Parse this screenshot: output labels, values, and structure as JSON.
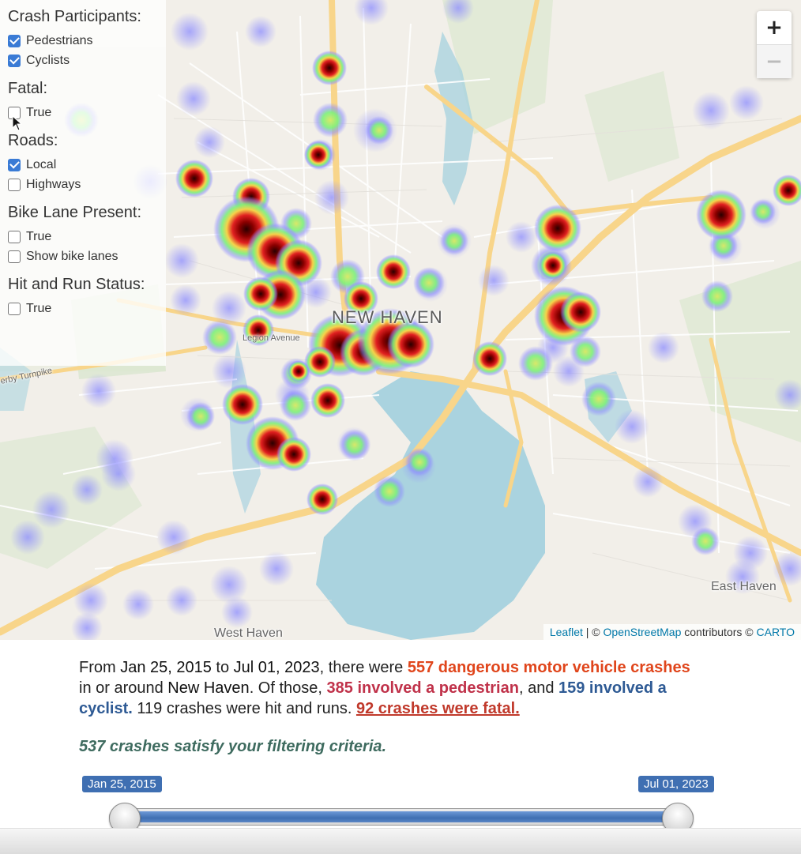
{
  "filters": {
    "groups": [
      {
        "heading": "Crash Participants:",
        "options": [
          {
            "label": "Pedestrians",
            "checked": true
          },
          {
            "label": "Cyclists",
            "checked": true
          }
        ]
      },
      {
        "heading": "Fatal:",
        "options": [
          {
            "label": "True",
            "checked": false
          }
        ]
      },
      {
        "heading": "Roads:",
        "options": [
          {
            "label": "Local",
            "checked": true
          },
          {
            "label": "Highways",
            "checked": false
          }
        ]
      },
      {
        "heading": "Bike Lane Present:",
        "options": [
          {
            "label": "True",
            "checked": false
          },
          {
            "label": "Show bike lanes",
            "checked": false
          }
        ]
      },
      {
        "heading": "Hit and Run Status:",
        "options": [
          {
            "label": "True",
            "checked": false
          }
        ]
      }
    ]
  },
  "map": {
    "labels": {
      "city": "NEW HAVEN",
      "east_haven": "East Haven",
      "west_haven": "West Haven",
      "legion_avenue": "Legion Avenue",
      "turnpike": "erby Turnpike"
    },
    "zoom": {
      "in": "+",
      "out": "−"
    },
    "attribution": {
      "leaflet": "Leaflet",
      "sep": " | © ",
      "osm": "OpenStreetMap",
      "contributors": " contributors © ",
      "carto": "CARTO"
    }
  },
  "summary": {
    "t1": "From ",
    "start_date": "Jan 25, 2015",
    "t2": " to ",
    "end_date": "Jul 01, 2023",
    "t3": ", there were ",
    "total_crashes": "557 dangerous motor vehicle crashes",
    "t4": " in or around ",
    "city": "New Haven",
    "t5": ". Of those, ",
    "pedestrian": "385 involved a pedestrian",
    "t6": ", and ",
    "cyclist": "159 involved a cyclist.",
    "t7": " 119 crashes were hit and runs. ",
    "fatal": "92 crashes were fatal."
  },
  "filtered_text": "537 crashes satisfy your filtering criteria.",
  "slider": {
    "start_label": "Jan 25, 2015",
    "end_label": "Jul 01, 2023",
    "range_fraction": [
      0,
      1
    ]
  },
  "colors": {
    "heat_low": "#8c8cff",
    "heat_mid": "#7cf07c",
    "heat_high": "#e02020",
    "heat_peak": "#3a0000",
    "accent_blue": "#3f6fb2"
  }
}
